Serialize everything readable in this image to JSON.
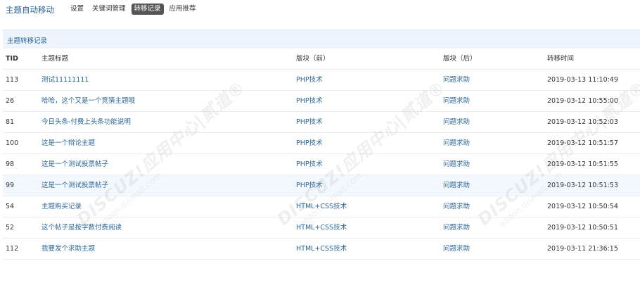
{
  "app": {
    "title": "主题自动移动"
  },
  "nav": [
    {
      "label": "设置",
      "active": false
    },
    {
      "label": "关键词管理",
      "active": false
    },
    {
      "label": "转移记录",
      "active": true
    },
    {
      "label": "应用推荐",
      "active": false
    }
  ],
  "panel": {
    "title": "主题转移记录"
  },
  "table": {
    "headers": {
      "tid": "TID",
      "title": "主题标题",
      "from": "版块（前）",
      "to": "版块（后）",
      "time": "转移时间"
    },
    "rows": [
      {
        "tid": "113",
        "title": "测试11111111",
        "from": "PHP技术",
        "to": "问题求助",
        "time": "2019-03-13 11:10:49"
      },
      {
        "tid": "26",
        "title": "哈哈，这个又是一个竞猜主题哦",
        "from": "PHP技术",
        "to": "问题求助",
        "time": "2019-03-12 10:55:00"
      },
      {
        "tid": "81",
        "title": "今日头条-付费上头条功能说明",
        "from": "PHP技术",
        "to": "问题求助",
        "time": "2019-03-12 10:52:03"
      },
      {
        "tid": "100",
        "title": "这是一个辩论主题",
        "from": "PHP技术",
        "to": "问题求助",
        "time": "2019-03-12 10:51:57"
      },
      {
        "tid": "98",
        "title": "这是一个测试投票帖子",
        "from": "PHP技术",
        "to": "问题求助",
        "time": "2019-03-12 10:51:55"
      },
      {
        "tid": "99",
        "title": "这是一个测试投票帖子",
        "from": "PHP技术",
        "to": "问题求助",
        "time": "2019-03-12 10:51:53"
      },
      {
        "tid": "54",
        "title": "主题购买记录",
        "from": "HTML+CSS技术",
        "to": "问题求助",
        "time": "2019-03-12 10:50:54"
      },
      {
        "tid": "52",
        "title": "这个帖子是按字数付费阅读",
        "from": "HTML+CSS技术",
        "to": "问题求助",
        "time": "2019-03-12 10:50:51"
      },
      {
        "tid": "112",
        "title": "我要发个求助主题",
        "from": "HTML+CSS技术",
        "to": "问题求助",
        "time": "2019-03-11 21:36:15"
      }
    ]
  },
  "watermark": {
    "brand": "DISCUZ!应用中心",
    "mark": "|贰道®",
    "url": "addon.dismall.com"
  }
}
